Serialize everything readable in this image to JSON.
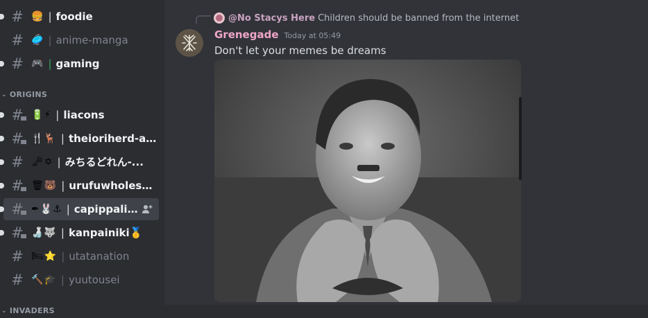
{
  "sidebar": {
    "channels_top": [
      {
        "emoji": "🍔",
        "name": "foodie",
        "style": "bright",
        "sep": "plain",
        "unread": true,
        "thread": false
      },
      {
        "emoji": "🥏",
        "name": "anime-manga",
        "style": "muted",
        "sep": "dim",
        "unread": false,
        "thread": false
      },
      {
        "emoji": "🎮",
        "name": "gaming",
        "style": "bright",
        "sep": "green",
        "unread": true,
        "thread": false
      }
    ],
    "category_origins": "ORIGINS",
    "channels_origins": [
      {
        "emoji": "🔋⚡",
        "name": "liacons",
        "style": "bright",
        "sep": "plain",
        "unread": true,
        "thread": true
      },
      {
        "emoji": "🍴🦌",
        "name": "theioriherd-ak...",
        "style": "bright",
        "sep": "plain",
        "unread": true,
        "thread": true
      },
      {
        "emoji": "🗝✡",
        "name": "みちるどれん-...",
        "style": "bright",
        "sep": "plain",
        "unread": true,
        "thread": false
      },
      {
        "emoji": "🗑🐻",
        "name": "urufuwholesom...",
        "style": "bright",
        "sep": "plain",
        "unread": true,
        "thread": true
      },
      {
        "emoji": "✒🐰⚓",
        "name": "capippalis...",
        "style": "bright",
        "sep": "plain",
        "unread": true,
        "thread": true,
        "active": true
      },
      {
        "emoji": "🍶🐺",
        "name": "kanpainiki🥇",
        "style": "bright",
        "sep": "plain",
        "unread": true,
        "thread": true
      },
      {
        "emoji": "🛏⭐",
        "name": "utatanation",
        "style": "muted",
        "sep": "dim",
        "unread": false,
        "thread": false
      },
      {
        "emoji": "🔨🎓",
        "name": "yuutousei",
        "style": "muted",
        "sep": "dim",
        "unread": false,
        "thread": false
      }
    ],
    "category_invaders": "INVADERS",
    "separator_char": "|",
    "hash_char": "#",
    "chevron_char": "⌄"
  },
  "message": {
    "reply_author": "@No Stacys Here",
    "reply_text": "Children should be banned from the internet",
    "author": "Grenegade",
    "timestamp": "Today at 05:49",
    "text": "Don't let your memes be dreams"
  },
  "colors": {
    "author": "#f0a6c8",
    "reply_author": "#c9a3c1",
    "unread_text": "#f2f3f5",
    "muted_text": "#80848e",
    "sidebar_bg": "#2b2d31",
    "chat_bg": "#313338"
  }
}
